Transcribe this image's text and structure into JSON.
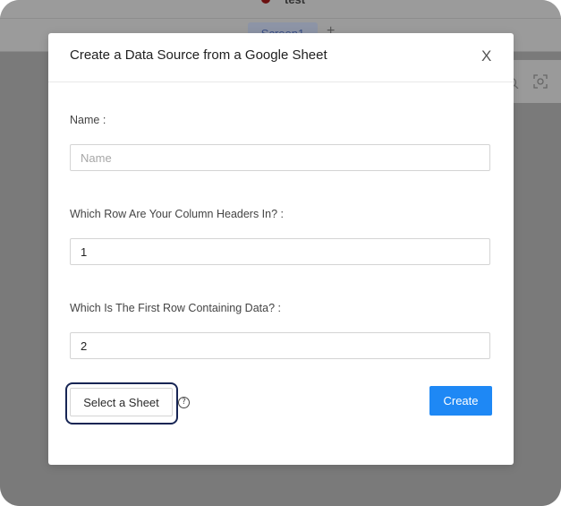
{
  "app": {
    "title": "test",
    "active_tab": "Screen1",
    "add_tab": "+"
  },
  "modal": {
    "title": "Create a Data Source from a Google Sheet",
    "close_label": "X",
    "fields": [
      {
        "label": "Name :",
        "value": "",
        "placeholder": "Name"
      },
      {
        "label": "Which Row Are Your Column Headers In? :",
        "value": "1",
        "placeholder": ""
      },
      {
        "label": "Which Is The First Row Containing Data? :",
        "value": "2",
        "placeholder": ""
      }
    ],
    "select_sheet_label": "Select a Sheet",
    "help_glyph": "?",
    "create_label": "Create"
  },
  "colors": {
    "primary": "#1e88f5",
    "focus_ring": "#172554",
    "overlay": "#7a7a7a"
  },
  "icons": {
    "close": "close-icon",
    "help": "help-circle-icon",
    "search": "search-icon",
    "focus": "focus-icon"
  }
}
